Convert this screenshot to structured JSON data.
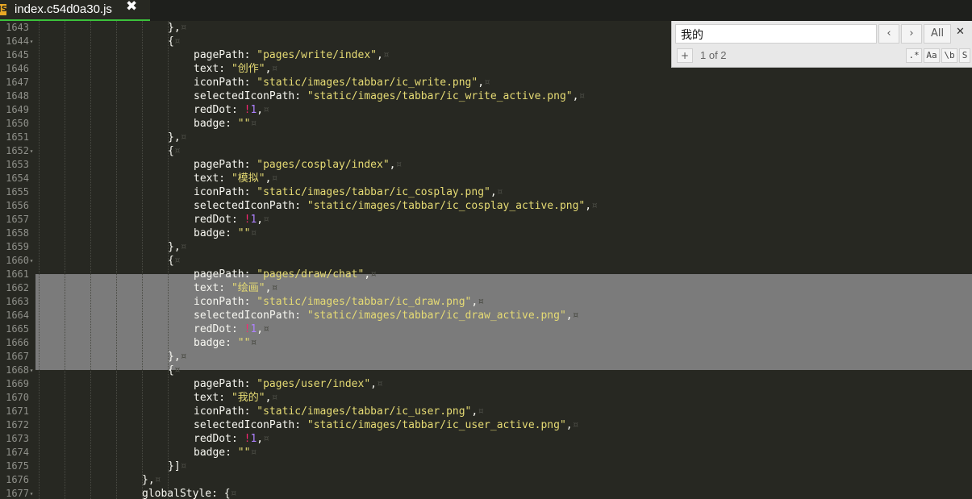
{
  "tab": {
    "title": "index.c54d0a30.js",
    "icon_label": "JS",
    "close": "✖"
  },
  "find": {
    "query": "我的",
    "prev": "‹",
    "next": "›",
    "all": "All",
    "close": "✕",
    "plus": "+",
    "count": "1 of 2",
    "opt_regex": ".*",
    "opt_case": "Aa",
    "opt_word": "\\b",
    "opt_sel": "S"
  },
  "lines": [
    {
      "no": "1643",
      "fold": "",
      "tokens": [
        [
          "ws",
          "············································································"
        ],
        [
          "p",
          "},"
        ],
        [
          "ws",
          "¤"
        ]
      ]
    },
    {
      "no": "1644",
      "fold": "▾",
      "tokens": [
        [
          "p",
          "{"
        ],
        [
          "ws",
          "¤"
        ]
      ]
    },
    {
      "no": "1645",
      "fold": "",
      "tokens": [
        [
          "p",
          "pagePath: "
        ],
        [
          "s",
          "\"pages/write/index\""
        ],
        [
          "p",
          ","
        ],
        [
          "ws",
          "¤"
        ]
      ]
    },
    {
      "no": "1646",
      "fold": "",
      "tokens": [
        [
          "p",
          "text: "
        ],
        [
          "s",
          "\"创作\""
        ],
        [
          "p",
          ","
        ],
        [
          "ws",
          "¤"
        ]
      ]
    },
    {
      "no": "1647",
      "fold": "",
      "tokens": [
        [
          "p",
          "iconPath: "
        ],
        [
          "s",
          "\"static/images/tabbar/ic_write.png\""
        ],
        [
          "p",
          ","
        ],
        [
          "ws",
          "¤"
        ]
      ]
    },
    {
      "no": "1648",
      "fold": "",
      "tokens": [
        [
          "p",
          "selectedIconPath: "
        ],
        [
          "s",
          "\"static/images/tabbar/ic_write_active.png\""
        ],
        [
          "p",
          ","
        ],
        [
          "ws",
          "¤"
        ]
      ]
    },
    {
      "no": "1649",
      "fold": "",
      "tokens": [
        [
          "p",
          "redDot: "
        ],
        [
          "op",
          "!"
        ],
        [
          "n",
          "1"
        ],
        [
          "p",
          ","
        ],
        [
          "ws",
          "¤"
        ]
      ]
    },
    {
      "no": "1650",
      "fold": "",
      "tokens": [
        [
          "p",
          "badge: "
        ],
        [
          "s",
          "\"\""
        ],
        [
          "ws",
          "¤"
        ]
      ]
    },
    {
      "no": "1651",
      "fold": "",
      "tokens": [
        [
          "p",
          "},"
        ],
        [
          "ws",
          "¤"
        ]
      ]
    },
    {
      "no": "1652",
      "fold": "▾",
      "tokens": [
        [
          "p",
          "{"
        ],
        [
          "ws",
          "¤"
        ]
      ]
    },
    {
      "no": "1653",
      "fold": "",
      "tokens": [
        [
          "p",
          "pagePath: "
        ],
        [
          "s",
          "\"pages/cosplay/index\""
        ],
        [
          "p",
          ","
        ],
        [
          "ws",
          "¤"
        ]
      ]
    },
    {
      "no": "1654",
      "fold": "",
      "tokens": [
        [
          "p",
          "text: "
        ],
        [
          "s",
          "\"模拟\""
        ],
        [
          "p",
          ","
        ],
        [
          "ws",
          "¤"
        ]
      ]
    },
    {
      "no": "1655",
      "fold": "",
      "tokens": [
        [
          "p",
          "iconPath: "
        ],
        [
          "s",
          "\"static/images/tabbar/ic_cosplay.png\""
        ],
        [
          "p",
          ","
        ],
        [
          "ws",
          "¤"
        ]
      ]
    },
    {
      "no": "1656",
      "fold": "",
      "tokens": [
        [
          "p",
          "selectedIconPath: "
        ],
        [
          "s",
          "\"static/images/tabbar/ic_cosplay_active.png\""
        ],
        [
          "p",
          ","
        ],
        [
          "ws",
          "¤"
        ]
      ]
    },
    {
      "no": "1657",
      "fold": "",
      "tokens": [
        [
          "p",
          "redDot: "
        ],
        [
          "op",
          "!"
        ],
        [
          "n",
          "1"
        ],
        [
          "p",
          ","
        ],
        [
          "ws",
          "¤"
        ]
      ]
    },
    {
      "no": "1658",
      "fold": "",
      "tokens": [
        [
          "p",
          "badge: "
        ],
        [
          "s",
          "\"\""
        ],
        [
          "ws",
          "¤"
        ]
      ]
    },
    {
      "no": "1659",
      "fold": "",
      "tokens": [
        [
          "p",
          "},"
        ],
        [
          "ws",
          "¤"
        ]
      ]
    },
    {
      "no": "1660",
      "fold": "▾",
      "tokens": [
        [
          "p",
          "{"
        ],
        [
          "ws",
          "¤"
        ]
      ]
    },
    {
      "no": "1661",
      "fold": "",
      "tokens": [
        [
          "p",
          "pagePath: "
        ],
        [
          "s",
          "\"pages/draw/chat\""
        ],
        [
          "p",
          ","
        ],
        [
          "ws",
          "¤"
        ]
      ]
    },
    {
      "no": "1662",
      "fold": "",
      "tokens": [
        [
          "p",
          "text: "
        ],
        [
          "s",
          "\"绘画\""
        ],
        [
          "p",
          ","
        ],
        [
          "ws",
          "¤"
        ]
      ]
    },
    {
      "no": "1663",
      "fold": "",
      "tokens": [
        [
          "p",
          "iconPath: "
        ],
        [
          "s",
          "\"static/images/tabbar/ic_draw.png\""
        ],
        [
          "p",
          ","
        ],
        [
          "ws",
          "¤"
        ]
      ]
    },
    {
      "no": "1664",
      "fold": "",
      "tokens": [
        [
          "p",
          "selectedIconPath: "
        ],
        [
          "s",
          "\"static/images/tabbar/ic_draw_active.png\""
        ],
        [
          "p",
          ","
        ],
        [
          "ws",
          "¤"
        ]
      ]
    },
    {
      "no": "1665",
      "fold": "",
      "tokens": [
        [
          "p",
          "redDot: "
        ],
        [
          "op",
          "!"
        ],
        [
          "n",
          "1"
        ],
        [
          "p",
          ","
        ],
        [
          "ws",
          "¤"
        ]
      ]
    },
    {
      "no": "1666",
      "fold": "",
      "tokens": [
        [
          "p",
          "badge: "
        ],
        [
          "s",
          "\"\""
        ],
        [
          "ws",
          "¤"
        ]
      ]
    },
    {
      "no": "1667",
      "fold": "",
      "tokens": [
        [
          "p",
          "},"
        ],
        [
          "ws",
          "¤"
        ]
      ]
    },
    {
      "no": "1668",
      "fold": "▾",
      "tokens": [
        [
          "p",
          "{"
        ],
        [
          "ws",
          "¤"
        ]
      ]
    },
    {
      "no": "1669",
      "fold": "",
      "tokens": [
        [
          "p",
          "pagePath: "
        ],
        [
          "s",
          "\"pages/user/index\""
        ],
        [
          "p",
          ","
        ],
        [
          "ws",
          "¤"
        ]
      ]
    },
    {
      "no": "1670",
      "fold": "",
      "tokens": [
        [
          "p",
          "text: "
        ],
        [
          "s",
          "\"我的\""
        ],
        [
          "p",
          ","
        ],
        [
          "ws",
          "¤"
        ]
      ]
    },
    {
      "no": "1671",
      "fold": "",
      "tokens": [
        [
          "p",
          "iconPath: "
        ],
        [
          "s",
          "\"static/images/tabbar/ic_user.png\""
        ],
        [
          "p",
          ","
        ],
        [
          "ws",
          "¤"
        ]
      ]
    },
    {
      "no": "1672",
      "fold": "",
      "tokens": [
        [
          "p",
          "selectedIconPath: "
        ],
        [
          "s",
          "\"static/images/tabbar/ic_user_active.png\""
        ],
        [
          "p",
          ","
        ],
        [
          "ws",
          "¤"
        ]
      ]
    },
    {
      "no": "1673",
      "fold": "",
      "tokens": [
        [
          "p",
          "redDot: "
        ],
        [
          "op",
          "!"
        ],
        [
          "n",
          "1"
        ],
        [
          "p",
          ","
        ],
        [
          "ws",
          "¤"
        ]
      ]
    },
    {
      "no": "1674",
      "fold": "",
      "tokens": [
        [
          "p",
          "badge: "
        ],
        [
          "s",
          "\"\""
        ],
        [
          "ws",
          "¤"
        ]
      ]
    },
    {
      "no": "1675",
      "fold": "",
      "tokens": [
        [
          "p",
          "}]"
        ],
        [
          "ws",
          "¤"
        ]
      ]
    },
    {
      "no": "1676",
      "fold": "",
      "tokens": [
        [
          "p",
          "},"
        ],
        [
          "ws",
          "¤"
        ]
      ]
    },
    {
      "no": "1677",
      "fold": "▾",
      "tokens": [
        [
          "p",
          "globalStyle: {"
        ],
        [
          "ws",
          "¤"
        ]
      ]
    }
  ],
  "colors": {
    "background": "#272822",
    "string": "#e6db74",
    "number": "#ae81ff",
    "operator": "#f92672",
    "selection": "#7b7b7b",
    "tab_accent": "#3bc23b"
  }
}
